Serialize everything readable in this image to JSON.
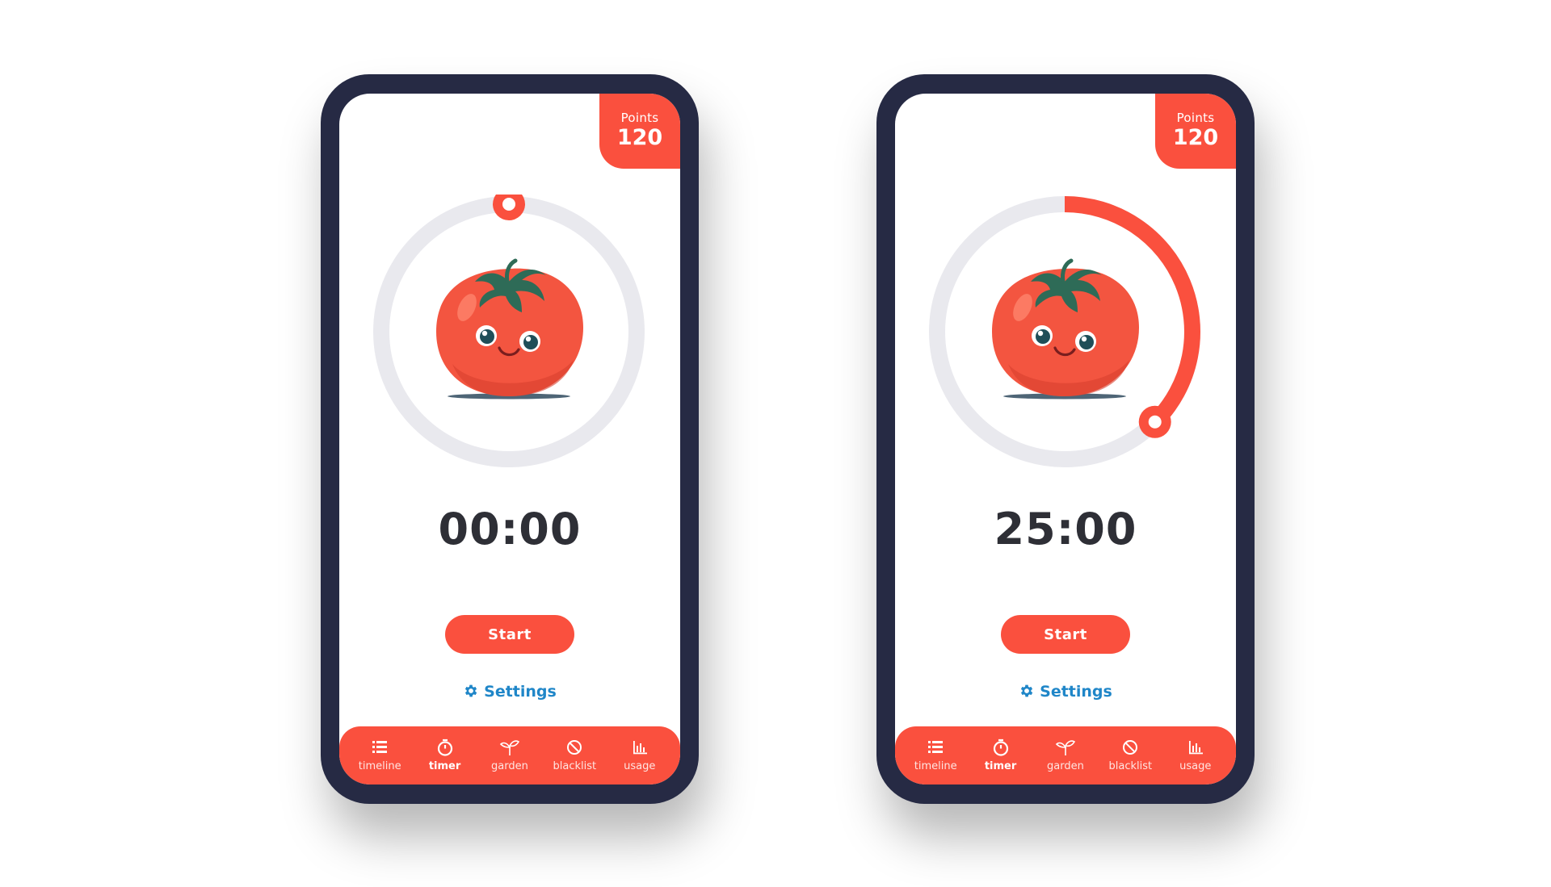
{
  "colors": {
    "accent": "#fa503e",
    "phone_frame": "#262a44",
    "track": "#e9e9ee",
    "settings_link": "#1f86c8",
    "time_text": "#2e2f36"
  },
  "screens": [
    {
      "points_label": "Points",
      "points_value": "120",
      "time": "00:00",
      "progress": 0,
      "start_label": "Start",
      "settings_label": "Settings",
      "tabs": [
        {
          "label": "timeline",
          "icon": "list-icon",
          "active": false
        },
        {
          "label": "timer",
          "icon": "stopwatch-icon",
          "active": true
        },
        {
          "label": "garden",
          "icon": "sprout-icon",
          "active": false
        },
        {
          "label": "blacklist",
          "icon": "block-icon",
          "active": false
        },
        {
          "label": "usage",
          "icon": "bar-chart-icon",
          "active": false
        }
      ]
    },
    {
      "points_label": "Points",
      "points_value": "120",
      "time": "25:00",
      "progress": 0.375,
      "start_label": "Start",
      "settings_label": "Settings",
      "tabs": [
        {
          "label": "timeline",
          "icon": "list-icon",
          "active": false
        },
        {
          "label": "timer",
          "icon": "stopwatch-icon",
          "active": true
        },
        {
          "label": "garden",
          "icon": "sprout-icon",
          "active": false
        },
        {
          "label": "blacklist",
          "icon": "block-icon",
          "active": false
        },
        {
          "label": "usage",
          "icon": "bar-chart-icon",
          "active": false
        }
      ]
    }
  ]
}
